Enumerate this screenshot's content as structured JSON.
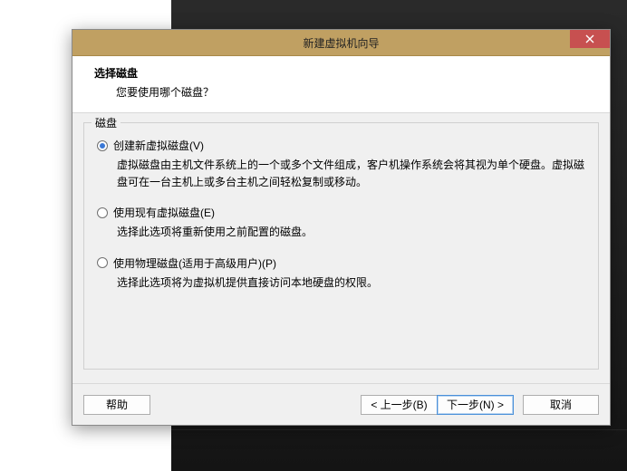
{
  "dialog": {
    "title": "新建虚拟机向导",
    "header_title": "选择磁盘",
    "header_sub": "您要使用哪个磁盘？",
    "group_label": "磁盘"
  },
  "options": {
    "create": {
      "label": "创建新虚拟磁盘(V)",
      "desc": "虚拟磁盘由主机文件系统上的一个或多个文件组成，客户机操作系统会将其视为单个硬盘。虚拟磁盘可在一台主机上或多台主机之间轻松复制或移动。"
    },
    "existing": {
      "label": "使用现有虚拟磁盘(E)",
      "desc": "选择此选项将重新使用之前配置的磁盘。"
    },
    "physical": {
      "label": "使用物理磁盘(适用于高级用户)(P)",
      "desc": "选择此选项将为虚拟机提供直接访问本地硬盘的权限。"
    }
  },
  "buttons": {
    "help": "帮助",
    "back": "< 上一步(B)",
    "next": "下一步(N) >",
    "cancel": "取消"
  }
}
